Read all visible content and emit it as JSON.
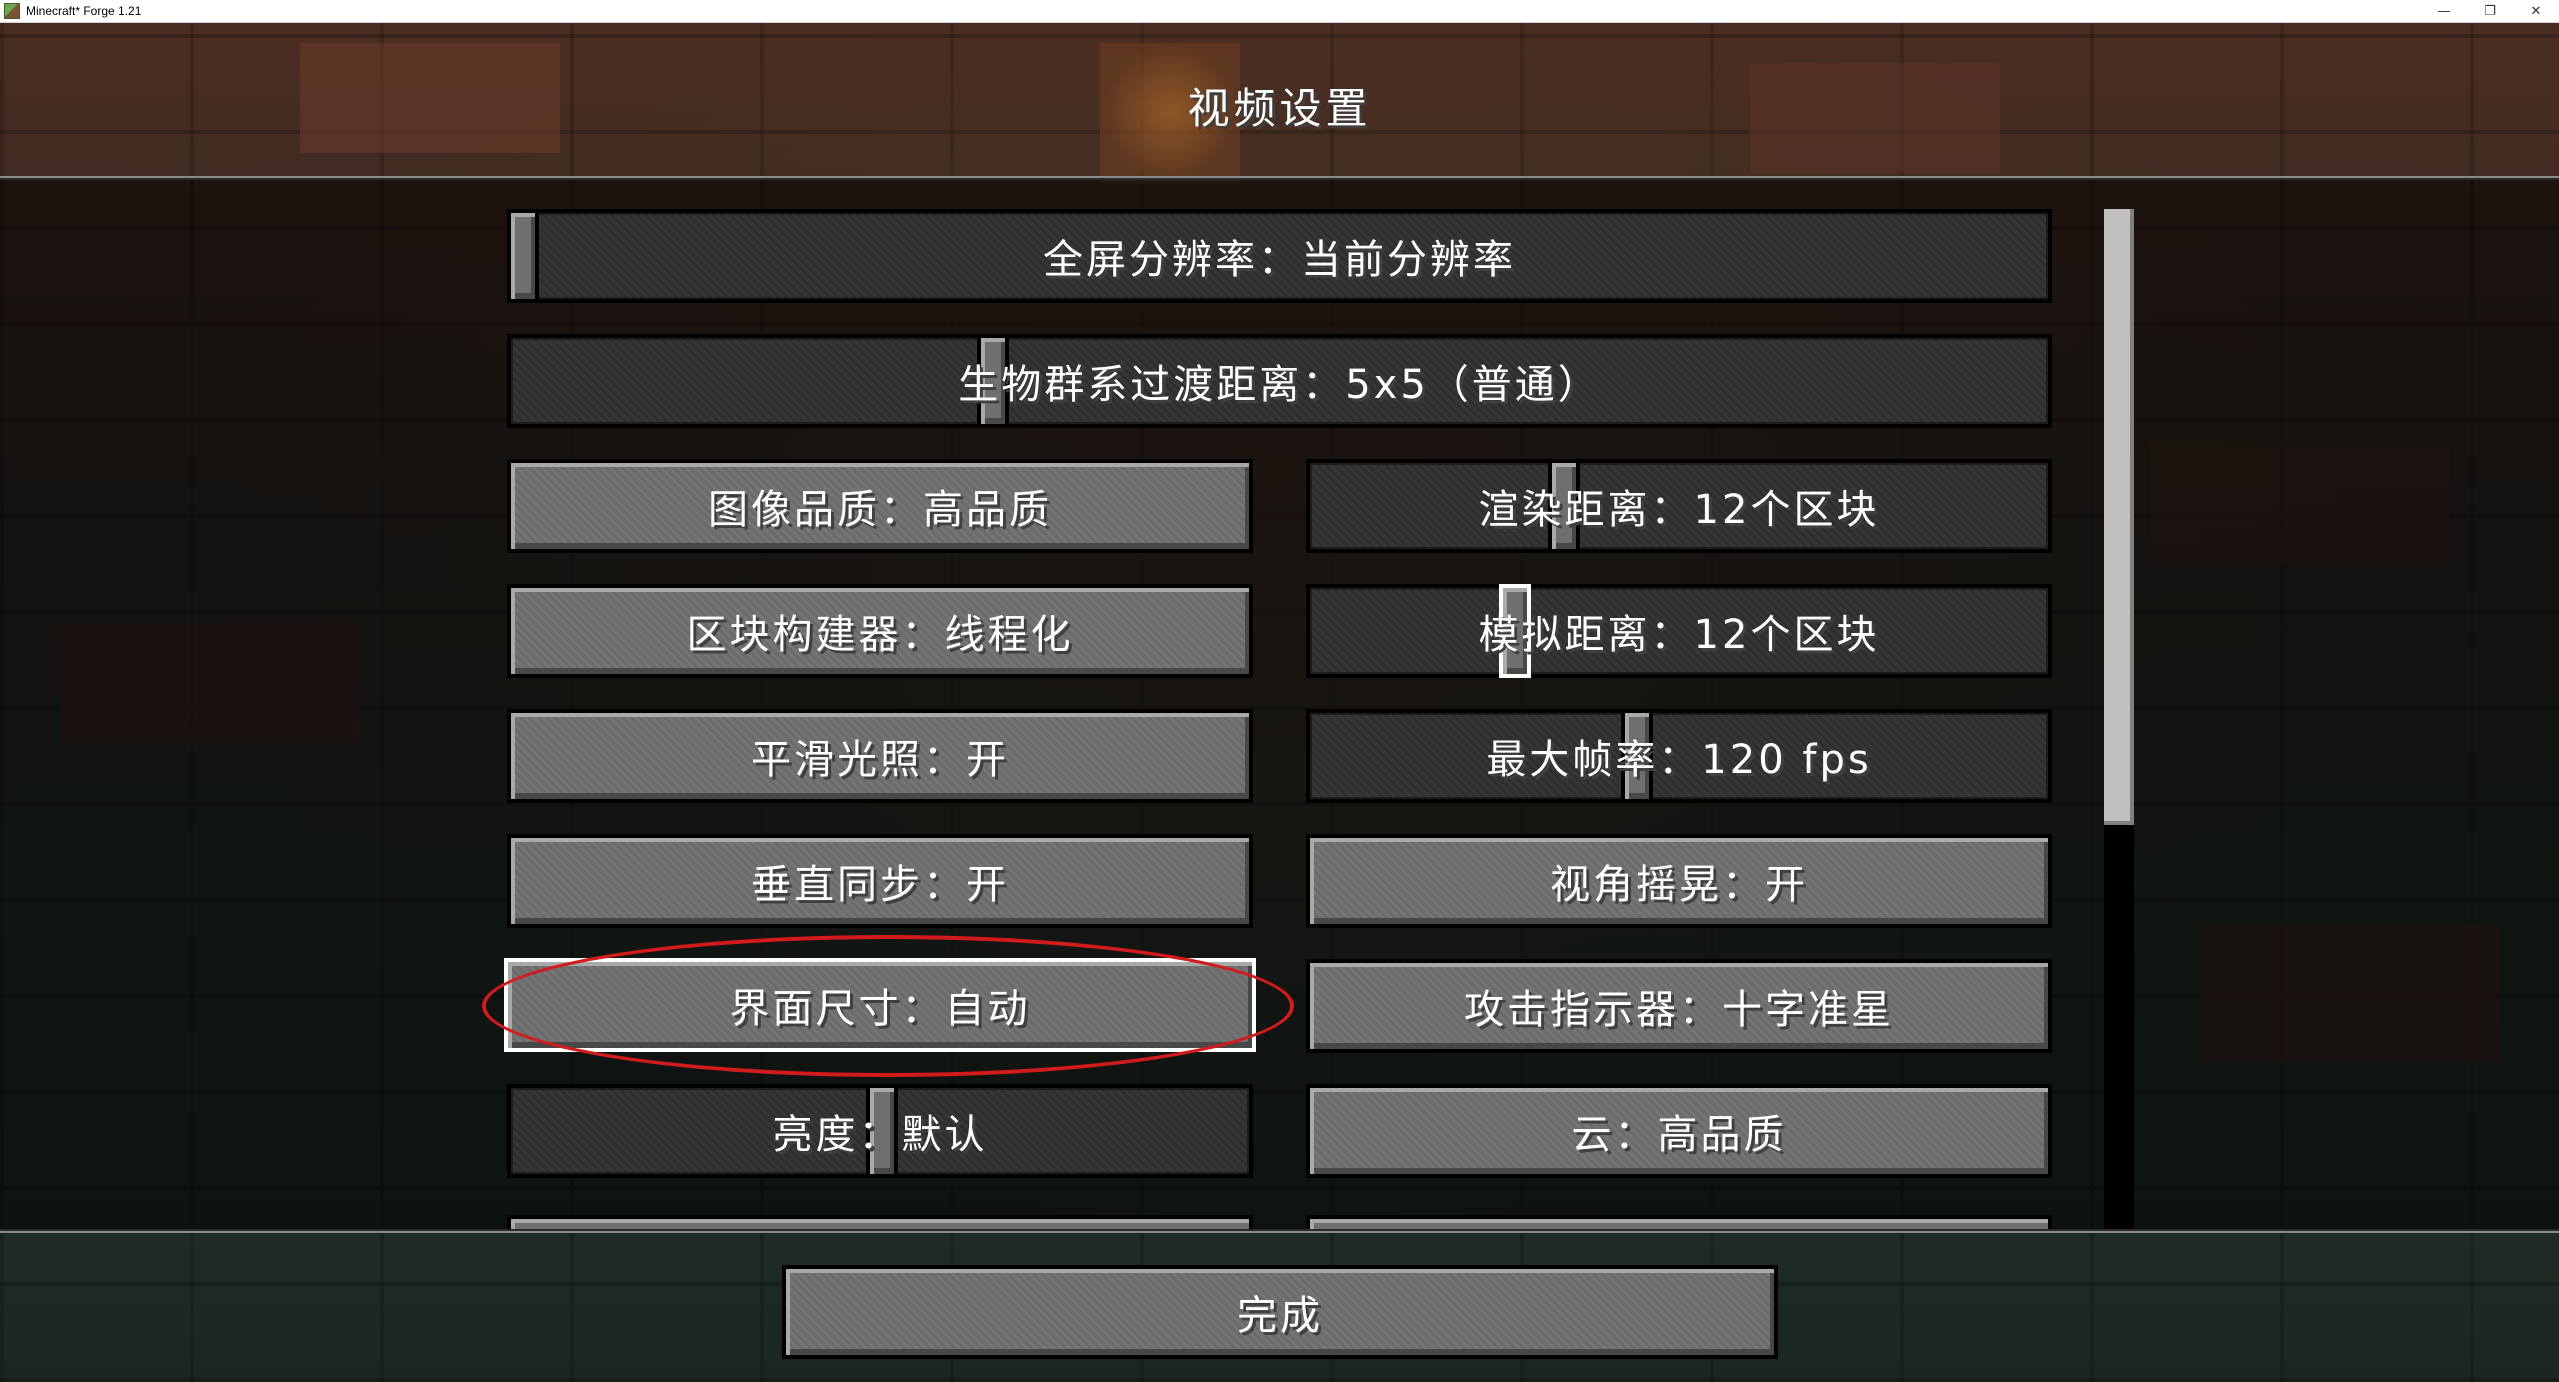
{
  "window": {
    "title": "Minecraft* Forge 1.21",
    "controls": {
      "minimize": "—",
      "restore": "❐",
      "close": "✕"
    }
  },
  "screen": {
    "title": "视频设置"
  },
  "options": {
    "fullscreen_resolution": "全屏分辨率：当前分辨率",
    "biome_blend": "生物群系过渡距离：5x5（普通）",
    "graphics": "图像品质：高品质",
    "render_distance": "渲染距离：12个区块",
    "chunk_builder": "区块构建器：线程化",
    "simulation_distance": "模拟距离：12个区块",
    "smooth_lighting": "平滑光照：开",
    "max_framerate": "最大帧率：120 fps",
    "vsync": "垂直同步：开",
    "view_bobbing": "视角摇晃：开",
    "gui_scale": "界面尺寸：自动",
    "attack_indicator": "攻击指示器：十字准星",
    "brightness": "亮度：默认",
    "clouds": "云：高品质"
  },
  "footer": {
    "done_label": "完成"
  },
  "colors": {
    "annotation": "#d21b1b",
    "button_face": "#6f6f6f",
    "slider_track": "#2f2f2f",
    "focus_border": "#ffffff"
  }
}
